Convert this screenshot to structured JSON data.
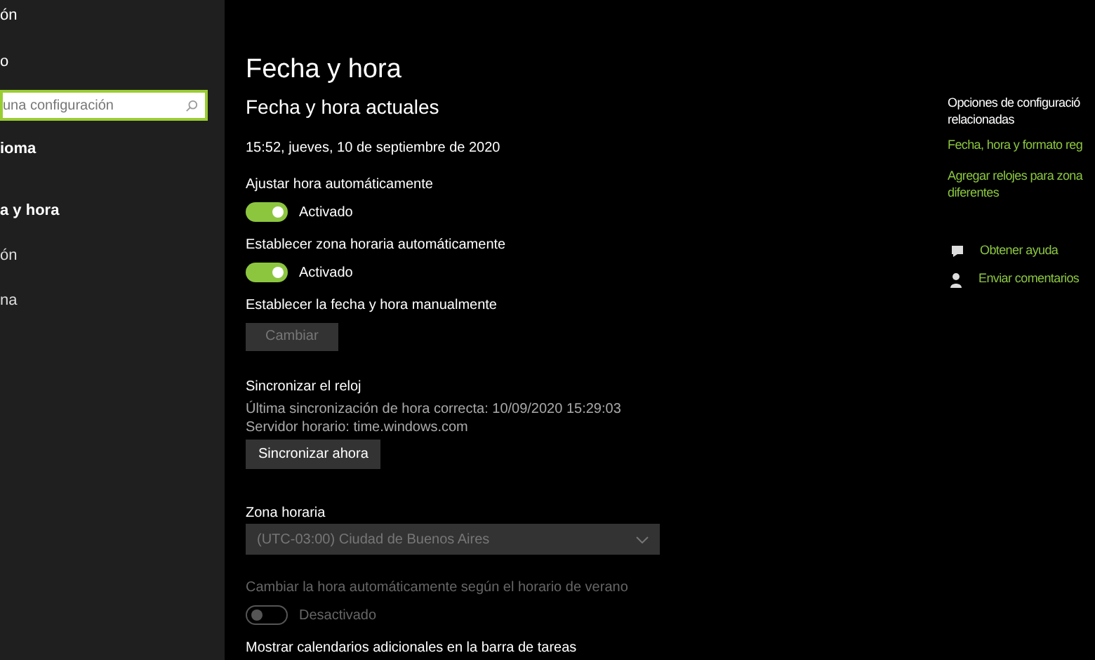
{
  "sidebar": {
    "top_text": "ón",
    "home_text": "o",
    "search": {
      "placeholder": "una configuración"
    },
    "section_title": "ioma",
    "items": [
      {
        "label": "a y hora",
        "selected": true
      },
      {
        "label": "ón",
        "selected": false
      },
      {
        "label": "na",
        "selected": false
      }
    ]
  },
  "main": {
    "title": "Fecha y hora",
    "subtitle": "Fecha y hora actuales",
    "current_datetime": "15:52, jueves, 10 de septiembre de 2020",
    "settings": [
      {
        "kind": "toggle",
        "label": "Ajustar hora automáticamente",
        "on": true,
        "disabled": false,
        "state_text": "Activado"
      },
      {
        "kind": "toggle",
        "label": "Establecer zona horaria automáticamente",
        "on": true,
        "disabled": false,
        "state_text": "Activado"
      },
      {
        "kind": "button",
        "label": "Establecer la fecha y hora manualmente",
        "button": "Cambiar",
        "disabled": true
      },
      {
        "kind": "sync",
        "label": "Sincronizar el reloj",
        "lines": [
          "Última sincronización de hora correcta: 10/09/2020 15:29:03",
          "Servidor horario: time.windows.com"
        ],
        "button": "Sincronizar ahora",
        "disabled": false
      },
      {
        "kind": "dropdown",
        "label": "Zona horaria",
        "value": "(UTC-03:00) Ciudad de Buenos Aires",
        "disabled": true
      },
      {
        "kind": "toggle",
        "label": "Cambiar la hora automáticamente según el horario de verano",
        "on": false,
        "disabled": true,
        "state_text": "Desactivado"
      },
      {
        "kind": "heading",
        "label": "Mostrar calendarios adicionales en la barra de tareas"
      }
    ]
  },
  "related": {
    "title": "Opciones de configuració relacionadas",
    "links": [
      "Fecha, hora y formato reg",
      "Agregar relojes para zona diferentes"
    ],
    "help": [
      {
        "kind": "help",
        "label": "Obtener ayuda"
      },
      {
        "kind": "feedback",
        "label": "Enviar comentarios"
      }
    ]
  }
}
